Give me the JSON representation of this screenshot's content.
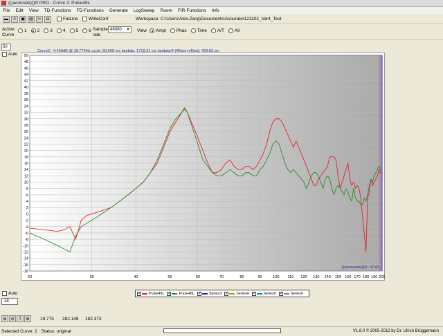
{
  "window": {
    "title": "(((acourate)))® PRO - Curve 2: Pulse48L"
  },
  "menu": [
    "File",
    "Edit",
    "View",
    "TD-Functions",
    "FD-Functions",
    "Generate",
    "LogSweep",
    "Room",
    "FIR-Functions",
    "Info"
  ],
  "toolbar": {
    "fatline_label": "FatLine",
    "writeconf_label": "WriteConf",
    "workspace_label": "Workspace: C:\\Users\\Alex.Zang\\Documents\\Acourate\\121102_Var4_Test"
  },
  "options": {
    "active_curve_label": "Active\nCurve",
    "curves": [
      "1",
      "2",
      "3",
      "4",
      "5",
      "6"
    ],
    "active_curve": "2",
    "sample_rate_label": "Sample\nrate",
    "sample_rate": "48000",
    "view_label": "View",
    "views": [
      "Ampl",
      "Phas",
      "Time",
      "A/T",
      "All"
    ],
    "active_view": "Ampl"
  },
  "axis_controls": {
    "ymax": "50",
    "auto_label": "Auto",
    "ymin": "-18"
  },
  "curve_info": "Curve2: -4.459dB @ 19.775Hz  cycle: 50.568 ms  lambda: 1719.31 cm  lambda/4 (Allison effect): 429.83 cm",
  "watermark": "(((acourate)))® - 6741",
  "colors": {
    "red": "#e8202a",
    "green": "#2a8a2a",
    "grid": "#c8c8c8",
    "blue_line": "#2020d0"
  },
  "chart_data": {
    "type": "line",
    "xscale": "log",
    "xlim": [
      20,
      200
    ],
    "ylim": [
      -18,
      50
    ],
    "x_ticks": [
      "20",
      "30",
      "40",
      "50",
      "60",
      "70",
      "80",
      "90",
      "100",
      "110",
      "120",
      "130",
      "140",
      "150",
      "160",
      "170",
      "180",
      "190",
      "200"
    ],
    "y_ticks": [
      "50",
      "48",
      "46",
      "44",
      "42",
      "40",
      "38",
      "36",
      "34",
      "32",
      "30",
      "28",
      "26",
      "24",
      "22",
      "20",
      "18",
      "16",
      "14",
      "12",
      "10",
      "8",
      "6",
      "4",
      "2",
      "0",
      "-2",
      "-4",
      "-6",
      "-8",
      "-10",
      "-12",
      "-14",
      "-16",
      "-18"
    ],
    "series": [
      {
        "name": "Pulse48L",
        "color": "#e8202a",
        "points": [
          [
            20,
            -4.5
          ],
          [
            22,
            -5
          ],
          [
            24,
            -5.5
          ],
          [
            25,
            -5
          ],
          [
            26,
            -4
          ],
          [
            27,
            -8
          ],
          [
            28,
            -2
          ],
          [
            29,
            -0.5
          ],
          [
            30,
            0
          ],
          [
            32,
            1
          ],
          [
            34,
            2
          ],
          [
            36,
            4
          ],
          [
            38,
            6
          ],
          [
            40,
            8
          ],
          [
            42,
            10
          ],
          [
            44,
            13
          ],
          [
            46,
            16
          ],
          [
            48,
            21
          ],
          [
            50,
            26
          ],
          [
            52,
            29
          ],
          [
            54,
            32
          ],
          [
            55,
            33
          ],
          [
            56,
            32
          ],
          [
            58,
            28
          ],
          [
            60,
            24
          ],
          [
            62,
            20
          ],
          [
            64,
            16
          ],
          [
            66,
            13
          ],
          [
            68,
            13
          ],
          [
            70,
            14
          ],
          [
            72,
            16
          ],
          [
            74,
            17
          ],
          [
            76,
            15
          ],
          [
            78,
            14
          ],
          [
            80,
            14
          ],
          [
            82,
            15
          ],
          [
            84,
            15
          ],
          [
            86,
            14
          ],
          [
            88,
            15
          ],
          [
            90,
            17
          ],
          [
            92,
            19
          ],
          [
            94,
            22
          ],
          [
            96,
            26
          ],
          [
            98,
            29
          ],
          [
            100,
            30
          ],
          [
            102,
            30
          ],
          [
            104,
            29
          ],
          [
            106,
            27
          ],
          [
            108,
            25
          ],
          [
            110,
            23
          ],
          [
            112,
            21
          ],
          [
            114,
            23
          ],
          [
            116,
            21
          ],
          [
            118,
            19
          ],
          [
            120,
            17
          ],
          [
            122,
            15
          ],
          [
            124,
            13
          ],
          [
            126,
            11
          ],
          [
            128,
            9
          ],
          [
            130,
            9
          ],
          [
            132,
            11
          ],
          [
            134,
            12
          ],
          [
            136,
            13
          ],
          [
            138,
            14
          ],
          [
            140,
            15
          ],
          [
            142,
            18
          ],
          [
            144,
            18
          ],
          [
            146,
            18
          ],
          [
            148,
            17
          ],
          [
            150,
            12
          ],
          [
            152,
            8
          ],
          [
            154,
            10
          ],
          [
            156,
            12
          ],
          [
            158,
            14
          ],
          [
            160,
            16
          ],
          [
            162,
            11
          ],
          [
            164,
            9
          ],
          [
            166,
            10
          ],
          [
            168,
            8
          ],
          [
            170,
            9
          ],
          [
            172,
            8
          ],
          [
            174,
            5
          ],
          [
            176,
            -1
          ],
          [
            178,
            -6
          ],
          [
            180,
            -12
          ],
          [
            182,
            5
          ],
          [
            184,
            7
          ],
          [
            186,
            11
          ],
          [
            188,
            9
          ],
          [
            190,
            10
          ],
          [
            192,
            11
          ],
          [
            194,
            12
          ],
          [
            196,
            14
          ],
          [
            198,
            13
          ],
          [
            200,
            13
          ]
        ]
      },
      {
        "name": "Pulse48L",
        "color": "#2a8a2a",
        "points": [
          [
            20,
            -6
          ],
          [
            22,
            -8
          ],
          [
            24,
            -10
          ],
          [
            25,
            -11
          ],
          [
            26,
            -12
          ],
          [
            27,
            -7
          ],
          [
            28,
            -4
          ],
          [
            30,
            -2
          ],
          [
            32,
            0
          ],
          [
            34,
            2
          ],
          [
            36,
            4
          ],
          [
            38,
            6
          ],
          [
            40,
            8
          ],
          [
            42,
            10
          ],
          [
            44,
            13
          ],
          [
            46,
            17
          ],
          [
            48,
            22
          ],
          [
            50,
            27
          ],
          [
            52,
            30
          ],
          [
            54,
            32
          ],
          [
            55,
            33.5
          ],
          [
            56,
            32
          ],
          [
            58,
            27
          ],
          [
            60,
            22
          ],
          [
            62,
            17
          ],
          [
            64,
            15
          ],
          [
            66,
            13
          ],
          [
            68,
            12
          ],
          [
            70,
            12
          ],
          [
            72,
            13
          ],
          [
            74,
            14
          ],
          [
            76,
            13
          ],
          [
            78,
            12
          ],
          [
            80,
            12
          ],
          [
            82,
            13
          ],
          [
            84,
            13
          ],
          [
            86,
            12
          ],
          [
            88,
            12
          ],
          [
            90,
            14
          ],
          [
            92,
            15
          ],
          [
            94,
            17
          ],
          [
            96,
            19
          ],
          [
            98,
            22
          ],
          [
            100,
            23
          ],
          [
            102,
            22
          ],
          [
            104,
            19
          ],
          [
            106,
            16
          ],
          [
            108,
            14
          ],
          [
            110,
            13
          ],
          [
            112,
            14
          ],
          [
            114,
            13
          ],
          [
            116,
            12
          ],
          [
            118,
            11
          ],
          [
            120,
            10
          ],
          [
            122,
            8
          ],
          [
            124,
            10
          ],
          [
            126,
            12
          ],
          [
            128,
            13
          ],
          [
            130,
            13
          ],
          [
            132,
            12
          ],
          [
            134,
            10
          ],
          [
            136,
            8
          ],
          [
            138,
            11
          ],
          [
            140,
            12
          ],
          [
            142,
            11
          ],
          [
            144,
            8
          ],
          [
            146,
            6
          ],
          [
            148,
            8
          ],
          [
            150,
            9
          ],
          [
            152,
            8
          ],
          [
            154,
            7
          ],
          [
            156,
            6
          ],
          [
            158,
            8
          ],
          [
            160,
            7
          ],
          [
            162,
            5
          ],
          [
            164,
            4
          ],
          [
            166,
            8
          ],
          [
            168,
            5
          ],
          [
            170,
            4
          ],
          [
            172,
            4
          ],
          [
            174,
            3
          ],
          [
            176,
            3
          ],
          [
            178,
            5
          ],
          [
            180,
            4
          ],
          [
            182,
            6
          ],
          [
            184,
            9
          ],
          [
            186,
            11
          ],
          [
            188,
            10
          ],
          [
            190,
            12
          ],
          [
            192,
            13
          ],
          [
            194,
            14
          ],
          [
            196,
            15
          ],
          [
            198,
            14
          ],
          [
            200,
            14
          ]
        ]
      }
    ]
  },
  "legend": [
    {
      "label": "Pulse48L",
      "color": "#e8202a"
    },
    {
      "label": "Pulse48L",
      "color": "#2a8a2a"
    },
    {
      "label": "Series3",
      "color": "#1f2a9a"
    },
    {
      "label": "Series4",
      "color": "#a0a000"
    },
    {
      "label": "Series5",
      "color": "#0090a0"
    },
    {
      "label": "Series6",
      "color": "#808080"
    }
  ],
  "readouts": {
    "r1": "19.775",
    "r2": "282.148",
    "r3": "182.373"
  },
  "status": {
    "selected": "Selected Curve: 2",
    "state": "Status: original",
    "copyright": "V1.8.0 © 2005-2012 by Dr. Ulrich Brüggemann"
  }
}
